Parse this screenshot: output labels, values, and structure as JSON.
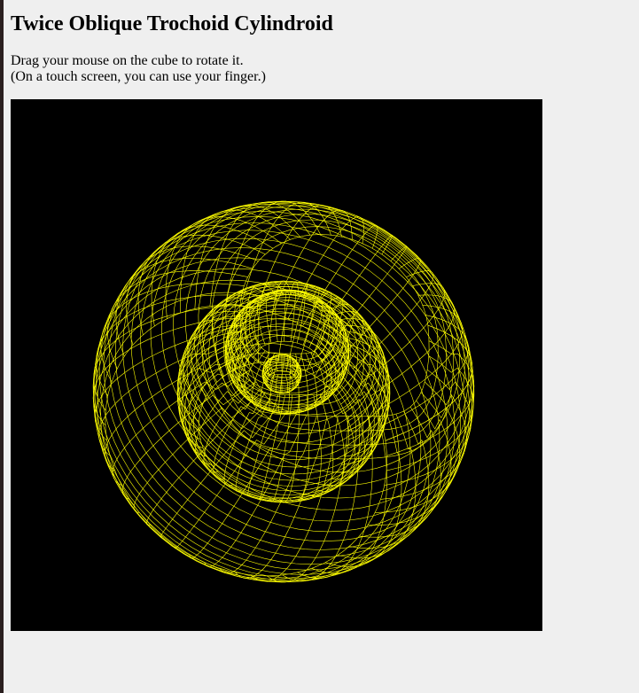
{
  "page": {
    "title": "Twice Oblique Trochoid Cylindroid",
    "instruction_line1": "Drag your mouse on the cube to rotate it.",
    "instruction_line2": "(On a touch screen, you can use your finger.)"
  },
  "colors": {
    "page_background": "#efefef",
    "canvas_background": "#000000",
    "wireframe": "#ffff00"
  }
}
